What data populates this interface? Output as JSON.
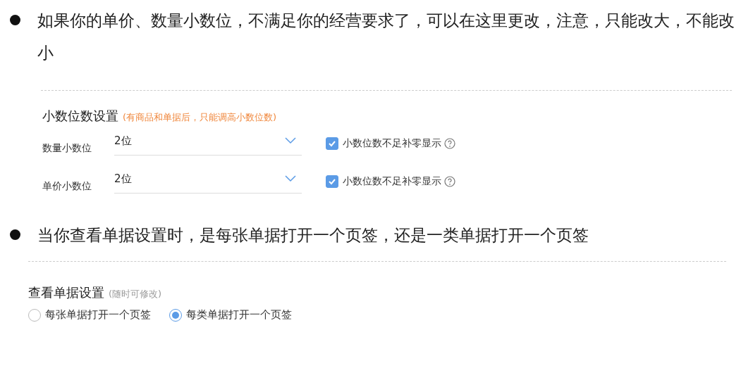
{
  "sections": [
    {
      "bullet_text": "如果你的单价、数量小数位，不满足你的经营要求了，可以在这里更改，注意，只能改大，不能改小",
      "panel": {
        "kind": "decimals",
        "title": "小数位数设置",
        "note": "(有商品和单据后，只能调高小数位数)",
        "rows": [
          {
            "label": "数量小数位",
            "value": "2位",
            "checkbox_label": "小数位数不足补零显示",
            "checked": true
          },
          {
            "label": "单价小数位",
            "value": "2位",
            "checkbox_label": "小数位数不足补零显示",
            "checked": true
          }
        ]
      }
    },
    {
      "bullet_text": "当你查看单据设置时，是每张单据打开一个页签，还是一类单据打开一个页签",
      "panel": {
        "kind": "view",
        "title": "查看单据设置",
        "note": "(随时可修改)",
        "options": [
          {
            "label": "每张单据打开一个页签",
            "selected": false
          },
          {
            "label": "每类单据打开一个页签",
            "selected": true
          }
        ]
      }
    }
  ]
}
